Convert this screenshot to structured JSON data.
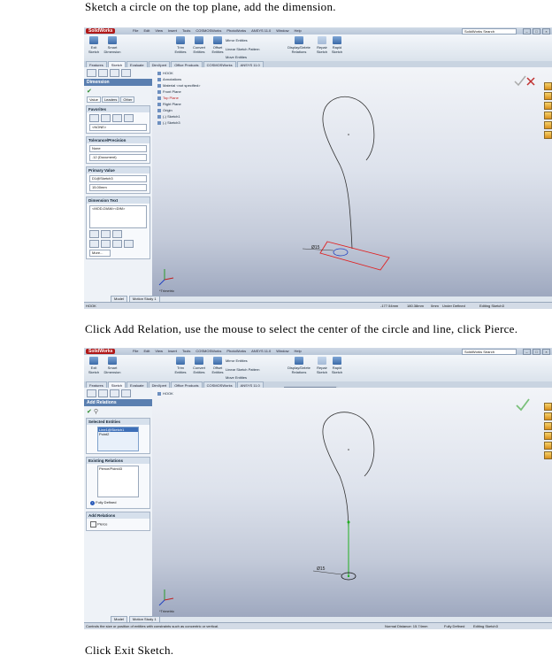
{
  "captions": [
    "Sketch a circle on the top plane, add the dimension.",
    "Click Add Relation, use the mouse to select the center of the circle and line, click Pierce.",
    "Click Exit Sketch."
  ],
  "app": {
    "logo": "SolidWorks",
    "menu": [
      "File",
      "Edit",
      "View",
      "Insert",
      "Tools",
      "COSMOSWorks",
      "PhotoWorks",
      "ANSYS 11.0",
      "Window",
      "Help"
    ],
    "search_placeholder": "SolidWorks Search",
    "title_short": "Sketch3..."
  },
  "ribbon": {
    "exit_sketch": "Exit Sketch",
    "smart_dimension": "Smart Dimension",
    "trim_entities": "Trim Entities",
    "convert_entities": "Convert Entities",
    "offset_entities": "Offset Entities",
    "mirror_entities": "Mirror Entities",
    "linear_sketch_pattern": "Linear Sketch Pattern",
    "move_entities": "Move Entities",
    "display_delete_relations": "Display/Delete Relations",
    "repair_sketch": "Repair Sketch",
    "rapid_sketch": "Rapid Sketch"
  },
  "tabs": [
    "Features",
    "Sketch",
    "Evaluate",
    "DimXpert",
    "Office Products",
    "COSMOSWorks",
    "ANSYS 11.0"
  ],
  "screen1": {
    "pm_title": "Dimension",
    "subtabs": [
      "Value",
      "Leaders",
      "Other"
    ],
    "favorites_title": "Favorites",
    "favorites_value": "<NONE>",
    "tolerance_title": "Tolerance/Precision",
    "tolerance_none": "None",
    "precision_value": ".12 (Document)",
    "primary_value_title": "Primary Value",
    "primary_name": "D1@Sketch3",
    "primary_value": "15.00mm",
    "dimension_text_title": "Dimension Text",
    "dimension_text_value": "<MOD-DIAM><DIM>",
    "more_label": "More...",
    "tree": [
      "HOOK",
      "Annotations",
      "Material <not specified>",
      "Front Plane",
      "Top Plane",
      "Right Plane",
      "Origin",
      "(-) Sketch1",
      "(-) Sketch3"
    ],
    "view_label": "*Trimetric",
    "dim_label": "Ø15",
    "model_tabs": [
      "Model",
      "Motion Study 1"
    ],
    "status": [
      "HOOK",
      "-177.54mm",
      "180.38mm",
      "0mm",
      "Under Defined",
      "Editing Sketch3"
    ]
  },
  "screen2": {
    "pm_title": "Add Relations",
    "selected_entities_title": "Selected Entities",
    "selected_entities": [
      "Line1@Sketch1",
      "Point2"
    ],
    "existing_relations_title": "Existing Relations",
    "existing_relation": "Pierce/Point43",
    "fully_defined": "Fully Defined",
    "add_relations_title": "Add Relations",
    "add_relation_option": "Pierce",
    "tree": [
      "HOOK"
    ],
    "view_label": "*Trimetric",
    "dim_label": "Ø15",
    "popup": [
      "Display/Delete Relations",
      "Add Relation",
      "Fully Define Sketch"
    ],
    "model_tabs": [
      "Model",
      "Motion Study 1"
    ],
    "status": [
      "Controls the size or position of entities with constraints such as concentric or vertical.",
      "Normal Distance: 15.74mm",
      "Fully Defined",
      "Editing Sketch3"
    ]
  }
}
